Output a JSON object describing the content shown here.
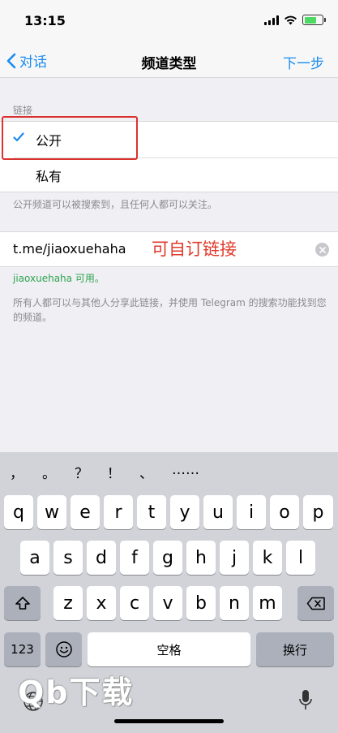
{
  "status_bar": {
    "time": "13:15"
  },
  "nav": {
    "back_label": "对话",
    "title": "频道类型",
    "next_label": "下一步"
  },
  "privacy": {
    "section_header": "链接",
    "options": [
      {
        "label": "公开",
        "selected": true
      },
      {
        "label": "私有",
        "selected": false
      }
    ],
    "footer": "公开频道可以被搜索到，且任何人都可以关注。"
  },
  "link": {
    "value": "t.me/jiaoxuehaha",
    "annotation": "可自订链接",
    "available": "jiaoxuehaha 可用。",
    "footer": "所有人都可以与其他人分享此链接，并使用 Telegram 的搜索功能找到您的频道。"
  },
  "keyboard": {
    "punctuation": [
      "，",
      "。",
      "？",
      "！",
      "、",
      "……"
    ],
    "row1": [
      "q",
      "w",
      "e",
      "r",
      "t",
      "y",
      "u",
      "i",
      "o",
      "p"
    ],
    "row2": [
      "a",
      "s",
      "d",
      "f",
      "g",
      "h",
      "j",
      "k",
      "l"
    ],
    "row3": [
      "z",
      "x",
      "c",
      "v",
      "b",
      "n",
      "m"
    ],
    "numbers_label": "123",
    "space_label": "空格",
    "return_label": "换行"
  },
  "watermark": "Qb下载",
  "colors": {
    "accent": "#1a8bf0",
    "annotation": "#e03b2c",
    "available": "#2ea44f"
  }
}
